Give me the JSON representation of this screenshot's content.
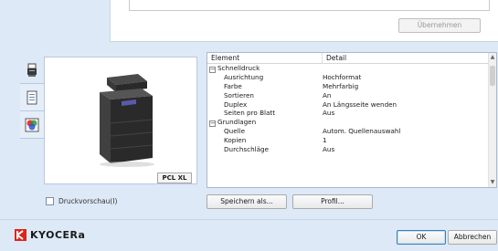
{
  "top": {
    "apply_label": "Übernehmen"
  },
  "side_tabs": [
    {
      "icon": "printer-icon"
    },
    {
      "icon": "document-icon"
    },
    {
      "icon": "color-icon"
    }
  ],
  "preview": {
    "badge": "PCL XL"
  },
  "preview_checkbox": {
    "label": "Druckvorschau(I)",
    "checked": false
  },
  "properties": {
    "header": {
      "element": "Element",
      "detail": "Detail"
    },
    "rows": [
      {
        "kind": "group",
        "element": "Schnelldruck",
        "detail": ""
      },
      {
        "kind": "child",
        "element": "Ausrichtung",
        "detail": "Hochformat"
      },
      {
        "kind": "child",
        "element": "Farbe",
        "detail": "Mehrfarbig"
      },
      {
        "kind": "child",
        "element": "Sortieren",
        "detail": "An"
      },
      {
        "kind": "child",
        "element": "Duplex",
        "detail": "An Längsseite wenden"
      },
      {
        "kind": "child",
        "element": "Seiten pro Blatt",
        "detail": "Aus"
      },
      {
        "kind": "group",
        "element": "Grundlagen",
        "detail": ""
      },
      {
        "kind": "child",
        "element": "Quelle",
        "detail": "Autom. Quellenauswahl"
      },
      {
        "kind": "child",
        "element": "Kopien",
        "detail": "1"
      },
      {
        "kind": "child",
        "element": "Durchschläge",
        "detail": "Aus"
      }
    ]
  },
  "buttons": {
    "save_as": "Speichern als...",
    "profile": "Profil..."
  },
  "footer": {
    "brand": "KYOCERa",
    "ok": "OK",
    "cancel": "Abbrechen"
  },
  "colors": {
    "background": "#dde9f6",
    "brand_red": "#d9261c",
    "ok_border": "#3c7fb1"
  }
}
